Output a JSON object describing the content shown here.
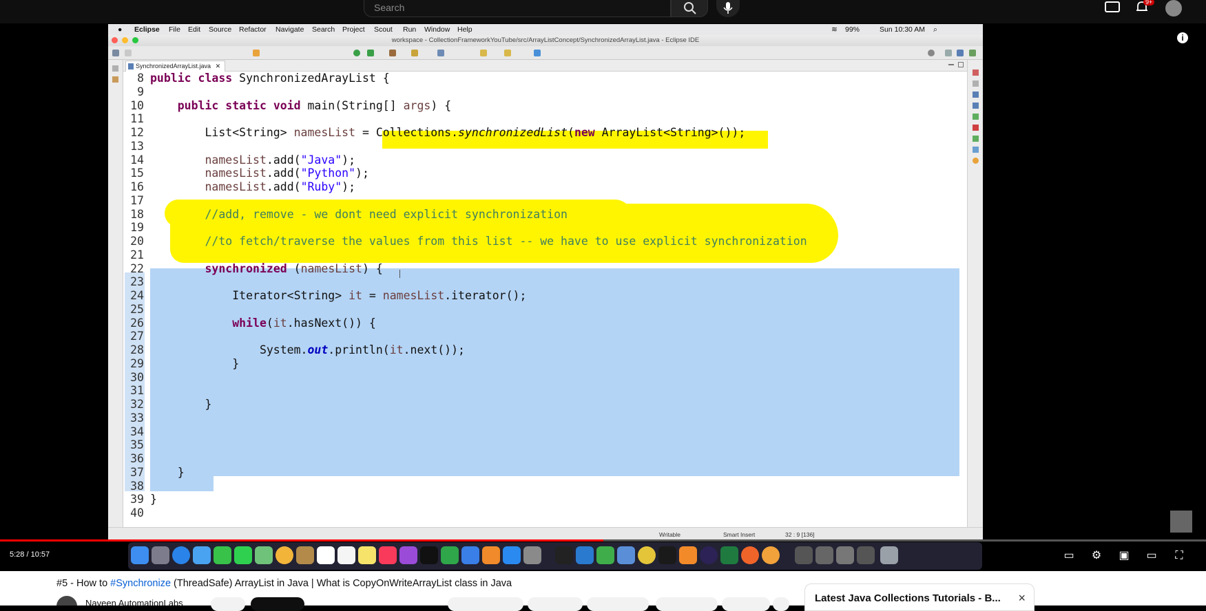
{
  "youtube": {
    "search_placeholder": "Search",
    "notifications_badge": "9+",
    "time_display": "5:28 / 10:57",
    "progress_fraction": 0.5,
    "video_title_prefix": "#5 - How to ",
    "video_title_tag": "#Synchronize",
    "video_title_rest": " (ThreadSafe) ArrayList in Java | What is CopyOnWriteArrayList class in Java",
    "channel_name": "Naveen AutomationLabs",
    "playlist_title": "Latest Java Collections Tutorials - B...",
    "playlist_close": "×"
  },
  "mac_menubar": {
    "apple": "",
    "items": [
      "Eclipse",
      "File",
      "Edit",
      "Source",
      "Refactor",
      "Navigate",
      "Search",
      "Project",
      "Scout",
      "Run",
      "Window",
      "Help"
    ],
    "battery": "99%",
    "clock": "Sun 10:30 AM"
  },
  "eclipse": {
    "window_title": "workspace - CollectionFrameworkYouTube/src/ArrayListConcept/SynchronizedArrayList.java - Eclipse IDE",
    "file_tab": "SynchronizedArrayList.java",
    "status": {
      "writable": "Writable",
      "insert_mode": "Smart Insert",
      "position": "32 : 9 [136]"
    }
  },
  "code_lines": [
    {
      "n": "8",
      "html": "<span class='kw'>public class</span> SynchronizedArayList {"
    },
    {
      "n": "9",
      "html": ""
    },
    {
      "n": "10",
      "html": "    <span class='kw'>public static void</span> main(String[] <span class='var'>args</span>) {"
    },
    {
      "n": "11",
      "html": ""
    },
    {
      "n": "12",
      "html": "        List&lt;String&gt; <span class='var'>namesList</span> = Collections.<span class='it'>synchronizedList</span>(<span class='kw'>new</span> ArrayList&lt;String&gt;());"
    },
    {
      "n": "13",
      "html": ""
    },
    {
      "n": "14",
      "html": "        <span class='var'>namesList</span>.add(<span class='str'>\"Java\"</span>);"
    },
    {
      "n": "15",
      "html": "        <span class='var'>namesList</span>.add(<span class='str'>\"Python\"</span>);"
    },
    {
      "n": "16",
      "html": "        <span class='var'>namesList</span>.add(<span class='str'>\"Ruby\"</span>);"
    },
    {
      "n": "17",
      "html": ""
    },
    {
      "n": "18",
      "html": "        <span class='cm'>//add, remove - we dont need explicit synchronization</span>"
    },
    {
      "n": "19",
      "html": ""
    },
    {
      "n": "20",
      "html": "        <span class='cm'>//to fetch/traverse the values from this list -- we have to use explicit synchronization</span>"
    },
    {
      "n": "21",
      "html": ""
    },
    {
      "n": "22",
      "html": "        <span class='kw'>synchronized</span> (<span class='var'>namesList</span>) {"
    },
    {
      "n": "23",
      "html": ""
    },
    {
      "n": "24",
      "html": "            Iterator&lt;String&gt; <span class='var'>it</span> = <span class='var'>namesList</span>.iterator();"
    },
    {
      "n": "25",
      "html": ""
    },
    {
      "n": "26",
      "html": "            <span class='kw'>while</span>(<span class='var'>it</span>.hasNext()) {"
    },
    {
      "n": "27",
      "html": ""
    },
    {
      "n": "28",
      "html": "                System.<span class='fld'>out</span>.println(<span class='var'>it</span>.next());"
    },
    {
      "n": "29",
      "html": "            }"
    },
    {
      "n": "30",
      "html": ""
    },
    {
      "n": "31",
      "html": ""
    },
    {
      "n": "32",
      "html": "        }"
    },
    {
      "n": "33",
      "html": ""
    },
    {
      "n": "34",
      "html": ""
    },
    {
      "n": "35",
      "html": ""
    },
    {
      "n": "36",
      "html": ""
    },
    {
      "n": "37",
      "html": "    }"
    },
    {
      "n": "38",
      "html": ""
    },
    {
      "n": "39",
      "html": "}"
    },
    {
      "n": "40",
      "html": ""
    }
  ],
  "colors": {
    "highlight_yellow": "#fff500",
    "selection_blue": "#b4d4f5",
    "keyword": "#7a0055",
    "string": "#2a00ff",
    "comment": "#3f7f5f",
    "progress_red": "#ff0000"
  }
}
